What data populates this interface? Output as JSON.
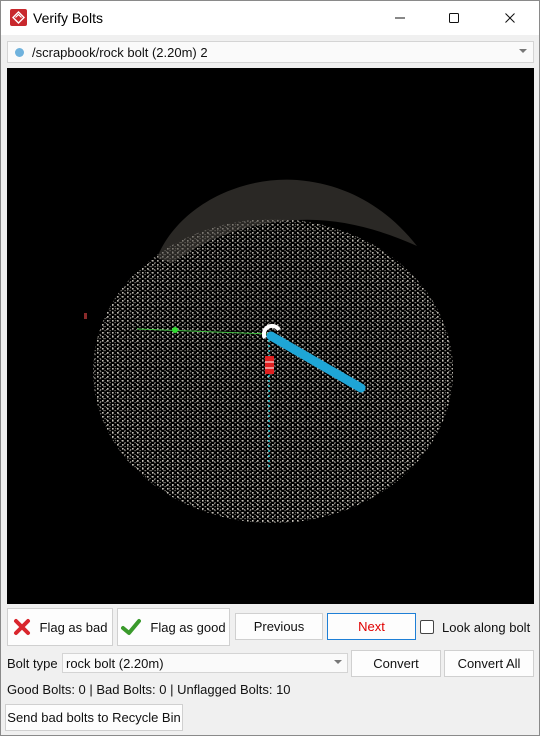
{
  "window": {
    "title": "Verify Bolts",
    "controls": {
      "minimize": "minimize",
      "maximize": "maximize",
      "close": "close"
    }
  },
  "path_selector": {
    "value": "/scrapbook/rock bolt (2.20m) 2",
    "dot_color": "#6fb2dd"
  },
  "viewer": {
    "background": "#000000",
    "bolt_color": "#1ea5d6",
    "cloud_color": "#b4b0a8"
  },
  "actions": {
    "flag_bad": "Flag as bad",
    "flag_good": "Flag as good",
    "previous": "Previous",
    "next": "Next",
    "look_along_bolt": "Look along bolt"
  },
  "bolt_type": {
    "label": "Bolt type",
    "value": "rock bolt (2.20m)",
    "convert": "Convert",
    "convert_all": "Convert All"
  },
  "status": "Good Bolts: 0 | Bad Bolts: 0 | Unflagged Bolts: 10",
  "recycle": "Send bad bolts to Recycle Bin"
}
